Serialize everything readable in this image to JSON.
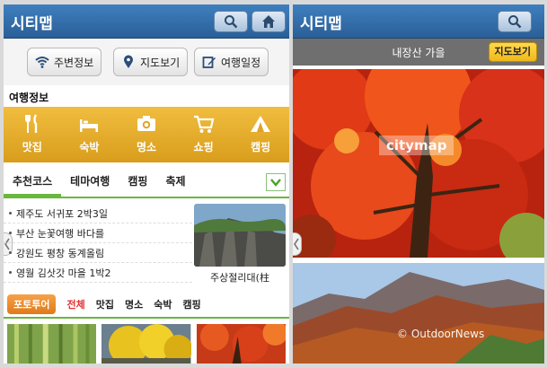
{
  "screen1": {
    "app_title": "시티맵",
    "quick": [
      {
        "label": "주변정보",
        "icon": "wifi-icon"
      },
      {
        "label": "지도보기",
        "icon": "map-pin-icon"
      },
      {
        "label": "여행일정",
        "icon": "edit-icon"
      }
    ],
    "section_title": "여행정보",
    "categories": [
      {
        "label": "맛집",
        "icon": "fork-knife-icon"
      },
      {
        "label": "숙박",
        "icon": "bed-icon"
      },
      {
        "label": "명소",
        "icon": "camera-icon"
      },
      {
        "label": "쇼핑",
        "icon": "cart-icon"
      },
      {
        "label": "캠핑",
        "icon": "tent-icon"
      }
    ],
    "tabs": [
      "추천코스",
      "테마여행",
      "캠핑",
      "축제"
    ],
    "courses": [
      "제주도 서귀포 2박3일",
      "부산 눈꽃여행 바다를",
      "강원도 평창 동계올림",
      "영월 김삿갓 마을 1박2"
    ],
    "thumb_caption": "주상절리대(柱",
    "photo_badge": "포토투어",
    "photo_filters": [
      "전체",
      "맛집",
      "명소",
      "숙박",
      "캠핑"
    ]
  },
  "screen2": {
    "app_title": "시티맵",
    "subhead_title": "내장산 가을",
    "map_button": "지도보기",
    "watermark_1": "citymap",
    "watermark_2": "© OutdoorNews"
  },
  "colors": {
    "topbar": "#2f6aa6",
    "category_bar": "#e6a92a",
    "accent_green": "#69b73e",
    "photo_badge": "#e98a2b",
    "active_filter": "#d33333"
  }
}
